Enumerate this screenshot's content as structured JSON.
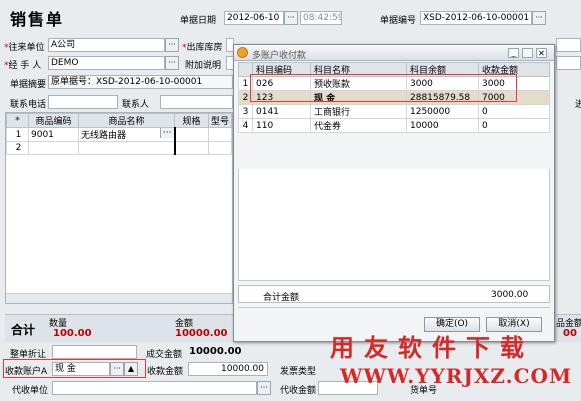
{
  "form": {
    "title": "销售单",
    "doc_date_label": "单据日期",
    "doc_date": "2012-06-10",
    "doc_time": "08:42:59",
    "doc_no_label": "单据编号",
    "doc_no": "XSD-2012-06-10-00001",
    "partner_label": "往来单位",
    "partner": "A公司",
    "warehouse_label": "出库库房",
    "handler_label": "经 手 人",
    "handler": "DEMO",
    "note_label": "附加说明",
    "summary_label": "单据摘要",
    "summary": "原单据号：XSD-2012-06-10-00001",
    "phone_label": "联系电话",
    "contact_label": "联系人",
    "right_cut": "进"
  },
  "grid": {
    "headers": [
      "*",
      "商品编码",
      "商品名称",
      "规格",
      "型号"
    ],
    "rows": [
      {
        "idx": "1",
        "code": "9001",
        "name": "无线路由器"
      },
      {
        "idx": "2",
        "code": "",
        "name": ""
      }
    ]
  },
  "totals": {
    "label": "合计",
    "qty_label": "数量",
    "qty": "100.00",
    "amount_label": "金额",
    "amount": "10000.00",
    "right_cut_label": "品金额",
    "right_cut_value": "00"
  },
  "bottom": {
    "discount_label": "整单折让",
    "deal_amount_label": "成交金额",
    "deal_amount": "10000.00",
    "account_label": "收款账户A",
    "account_value": "现    金",
    "receipt_label": "收款金额",
    "receipt_value": "10000.00",
    "invoice_label": "发票类型",
    "agent_unit_label": "代收单位",
    "agent_amount_label": "代收金额",
    "ticket_label": "货单号"
  },
  "dialog": {
    "title": "多账户收付款",
    "headers": [
      "科目编码",
      "科目名称",
      "科目余额",
      "收款金额"
    ],
    "rows": [
      {
        "idx": "1",
        "code": "026",
        "name": "预收账款",
        "balance": "3000",
        "receipt": "3000"
      },
      {
        "idx": "2",
        "code": "123",
        "name": "现    金",
        "balance": "28815879.58",
        "receipt": "7000"
      },
      {
        "idx": "3",
        "code": "0141",
        "name": "工商银行",
        "balance": "1250000",
        "receipt": "0"
      },
      {
        "idx": "4",
        "code": "110",
        "name": "代金券",
        "balance": "10000",
        "receipt": "0"
      }
    ],
    "total_label": "合计金额",
    "total_value": "3000.00",
    "ok_label": "确定(O)",
    "cancel_label": "取消(X)"
  },
  "watermark": {
    "line1": "用友软件下载",
    "line2": "WWW.YYRJXZ.COM"
  },
  "colors": {
    "highlight_box": "#e23a3a",
    "watermark": "#d72828"
  }
}
